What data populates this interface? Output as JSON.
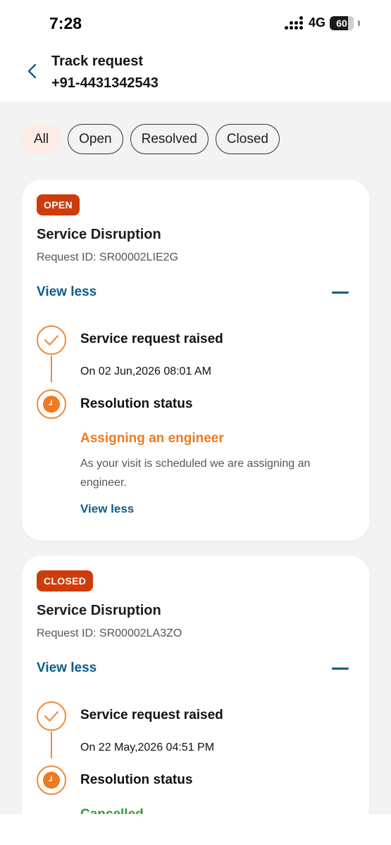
{
  "status_bar": {
    "time": "7:28",
    "network": "4G",
    "battery": "60"
  },
  "header": {
    "title": "Track request",
    "phone": "+91-4431342543",
    "back_icon": "chevron-left-icon"
  },
  "filters": [
    {
      "label": "All",
      "active": true
    },
    {
      "label": "Open",
      "active": false
    },
    {
      "label": "Resolved",
      "active": false
    },
    {
      "label": "Closed",
      "active": false
    }
  ],
  "requests": [
    {
      "badge": "OPEN",
      "title": "Service Disruption",
      "request_id": "Request ID: SR00002LIE2G",
      "toggle_label": "View less",
      "steps": {
        "raised_title": "Service request raised",
        "raised_date": "On 02 Jun,2026 08:01 AM",
        "resolution_title": "Resolution status",
        "resolution_status": "Assigning an engineer",
        "resolution_desc": "As your visit is scheduled we are assigning an engineer.",
        "inner_toggle": "View less"
      }
    },
    {
      "badge": "CLOSED",
      "title": "Service Disruption",
      "request_id": "Request ID: SR00002LA3ZO",
      "toggle_label": "View less",
      "steps": {
        "raised_title": "Service request raised",
        "raised_date": "On 22 May,2026 04:51 PM",
        "resolution_title": "Resolution status",
        "resolution_status": "Cancelled"
      }
    }
  ],
  "colors": {
    "accent": "#cf3c0c",
    "link": "#0d5c86",
    "progress": "#f08a3a",
    "pending": "#ef7a1d",
    "cancelled": "#2e9e37"
  }
}
